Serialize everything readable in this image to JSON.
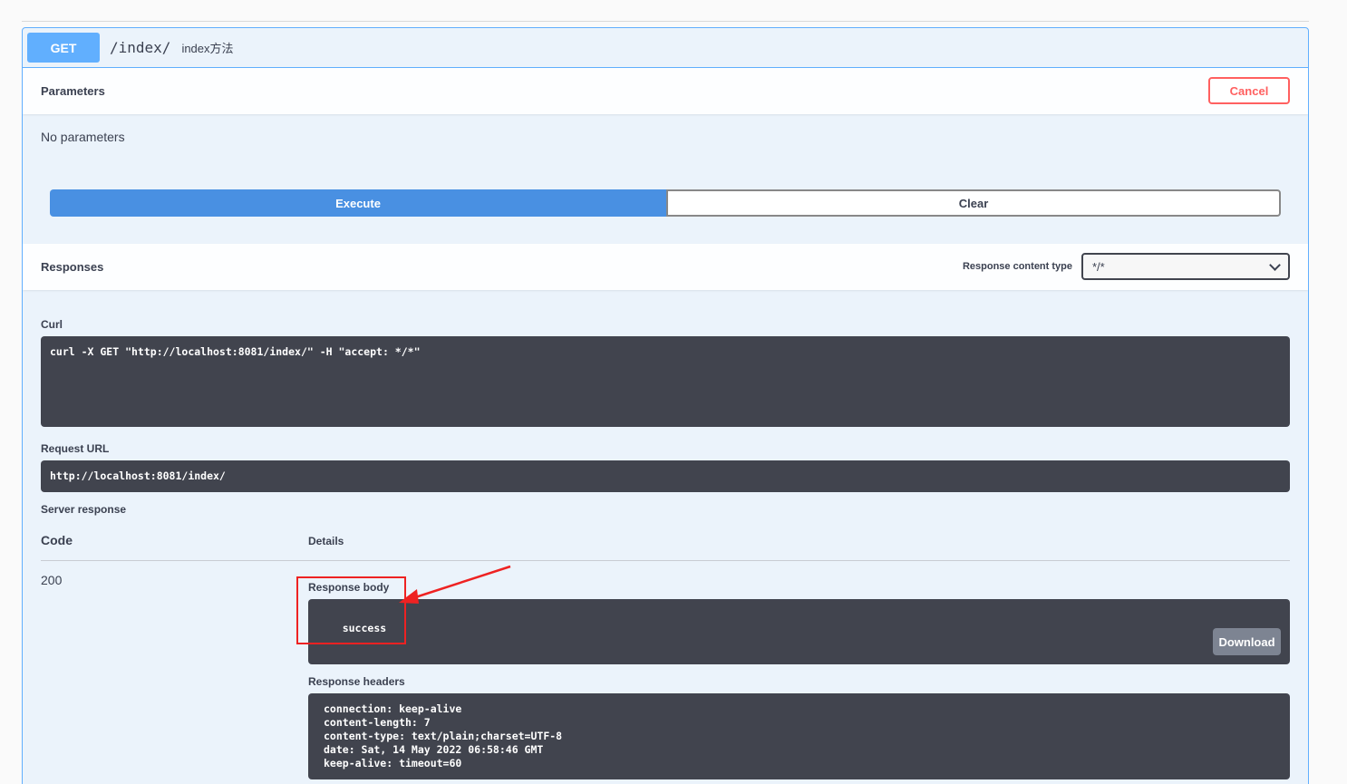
{
  "operation": {
    "method": "GET",
    "path": "/index/",
    "description": "index方法"
  },
  "parameters": {
    "title": "Parameters",
    "cancel_label": "Cancel",
    "empty_text": "No parameters"
  },
  "actions": {
    "execute_label": "Execute",
    "clear_label": "Clear"
  },
  "responses": {
    "title": "Responses",
    "content_type_label": "Response content type",
    "content_type_value": "*/*"
  },
  "curl": {
    "label": "Curl",
    "command": "curl -X GET \"http://localhost:8081/index/\" -H \"accept: */*\""
  },
  "request_url": {
    "label": "Request URL",
    "value": "http://localhost:8081/index/"
  },
  "server_response": {
    "label": "Server response",
    "code_header": "Code",
    "details_header": "Details",
    "code": "200",
    "body_label": "Response body",
    "body": "success",
    "download_label": "Download",
    "headers_label": "Response headers",
    "headers": "connection: keep-alive\ncontent-length: 7\ncontent-type: text/plain;charset=UTF-8\ndate: Sat, 14 May 2022 06:58:46 GMT\nkeep-alive: timeout=60"
  },
  "colors": {
    "get_blue": "#61affe",
    "execute_blue": "#4990e2",
    "cancel_red": "#ff6060",
    "code_bg": "#41444e",
    "annotation_red": "#ee2222"
  }
}
